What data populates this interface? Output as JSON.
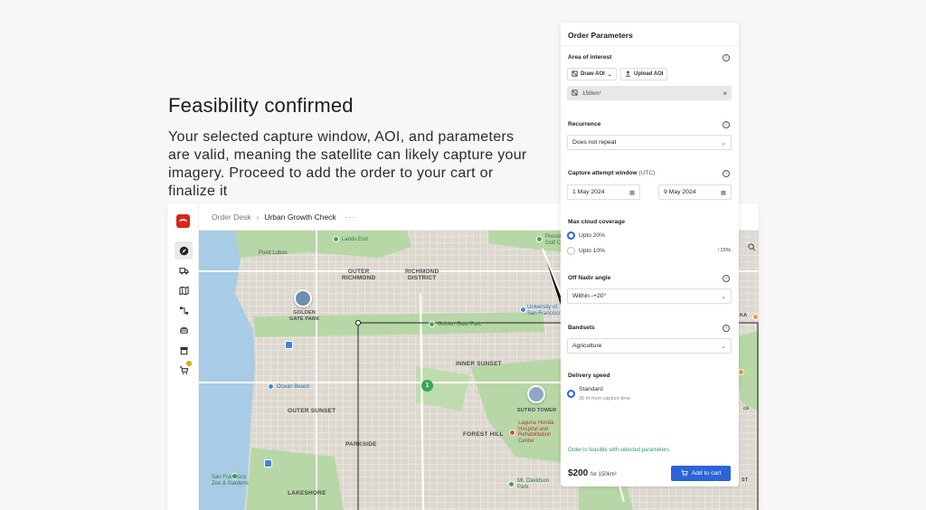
{
  "hero": {
    "title": "Feasibility confirmed",
    "body": "Your selected capture window, AOI, and parameters are valid, meaning the satellite can likely capture your imagery. Proceed to add the order to your cart or finalize it"
  },
  "app": {
    "breadcrumb": {
      "root": "Order Desk",
      "current": "Urban Growth Check",
      "more": "···"
    },
    "rail_icons": [
      "compass-icon",
      "truck-icon",
      "map-icon",
      "workflow-icon",
      "satellite-icon",
      "store-icon",
      "cart-icon"
    ]
  },
  "map": {
    "labels": [
      {
        "text": "OUTER\nRICHMOND"
      },
      {
        "text": "RICHMOND\nDISTRICT"
      },
      {
        "text": "INNER SUNSET"
      },
      {
        "text": "OUTER SUNSET"
      },
      {
        "text": "PARKSIDE"
      },
      {
        "text": "FOREST HILL"
      },
      {
        "text": "LAKESHORE"
      },
      {
        "text": "GOLDEN\nGATE PARK"
      },
      {
        "text": "SUTRO TOWER"
      }
    ],
    "pois": [
      {
        "text": "Lands End"
      },
      {
        "text": "Presidio\nGolf Course"
      },
      {
        "text": "Point Lobos"
      },
      {
        "text": "Golden Gate Park"
      },
      {
        "text": "University of\nSan Francisco"
      },
      {
        "text": "Ocean Beach"
      },
      {
        "text": "Laguna Honda\nHospital and\nRehabilitation\nCenter"
      },
      {
        "text": "San Francisco\nZoo & Gardens"
      },
      {
        "text": "Mt. Davidson\nPark"
      }
    ],
    "marker_number": "1",
    "edge_labels": [
      "KA",
      "ck",
      "ST"
    ]
  },
  "panel": {
    "title": "Order Parameters",
    "aoi": {
      "label": "Area of interest",
      "draw_label": "Draw AOI",
      "upload_label": "Upload AOI",
      "area_value": "150km²"
    },
    "recurrence": {
      "label": "Recurrence",
      "value": "Does not repeat"
    },
    "capture_window": {
      "label": "Capture attempt window",
      "sub": "(UTC)",
      "start": "1 May 2024",
      "end": "9 May 2024"
    },
    "cloud": {
      "label": "Max cloud coverage",
      "options": [
        "Upto 20%",
        "Upto 10%"
      ],
      "selected": 0,
      "hint": "↑15%"
    },
    "nadir": {
      "label": "Off Nadir angle",
      "value": "Within -+20°"
    },
    "bandsets": {
      "label": "Bandsets",
      "value": "Agriculture"
    },
    "delivery": {
      "label": "Delivery speed",
      "option": "Standard",
      "option_sub": "36 hr from capture time"
    },
    "feasible_text": "Order is feasible with selected parameters",
    "price": "$200",
    "price_per": "for 150km²",
    "add_to_cart": "Add to cart"
  },
  "colors": {
    "accent": "#2b63d9",
    "feasible": "#2a9d5a",
    "logo": "#d9251d",
    "park": "#b7d7a6",
    "water": "#a8cbe6"
  }
}
